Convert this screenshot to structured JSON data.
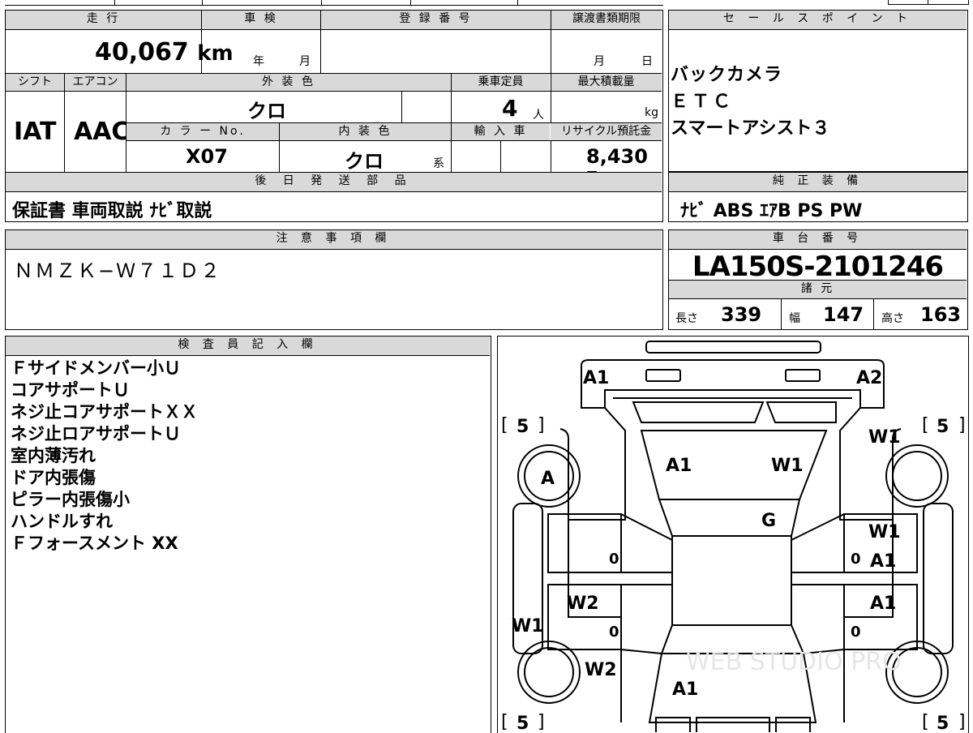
{
  "top": {
    "headers": {
      "mileage": "走 行",
      "shaken": "車 検",
      "reg_no": "登 録 番 号",
      "transfer_deadline": "譲渡書類期限",
      "shift": "シフト",
      "aircon": "エアコン",
      "exterior_color": "外 装 色",
      "capacity": "乗車定員",
      "max_load": "最大積載量",
      "color_no": "カ ラ ー No.",
      "interior_color": "内 装 色",
      "import": "輸 入 車",
      "recycle_fee": "リサイクル預託金",
      "post_parts": "後 日 発 送 部 品"
    },
    "mileage": "40,067",
    "mileage_unit": "km",
    "shaken_year": "年",
    "shaken_month": "月",
    "deadline_month": "月",
    "deadline_day": "日",
    "shift": "IAT",
    "aircon": "AAC",
    "exterior_color": "クロ",
    "capacity": "4",
    "capacity_unit": "人",
    "load_unit": "kg",
    "color_no": "X07",
    "interior_color": "クロ",
    "interior_suffix": "系",
    "recycle_fee": "8,430",
    "recycle_unit": "円",
    "post_parts": "保証書 車両取説 ﾅﾋﾞ取説"
  },
  "sales": {
    "header": "セ ー ル ス ポ イ ン ト",
    "items": [
      "バックカメラ",
      "ＥＴＣ",
      "スマートアシスト３"
    ]
  },
  "equipment": {
    "header": "純 正 装 備",
    "value": "ﾅﾋﾞ ABS ｴｱB PS PW"
  },
  "notes": {
    "header": "注 意 事 項 欄",
    "value": "ＮＭＺＫ−Ｗ７１Ｄ２"
  },
  "chassis": {
    "header": "車 台 番 号",
    "value": "LA150S-2101246",
    "specs_header": "諸 元",
    "length_label": "長さ",
    "length": "339",
    "width_label": "幅",
    "width": "147",
    "height_label": "高さ",
    "height": "163"
  },
  "inspector": {
    "header": "検 査 員 記 入 欄",
    "items": [
      "Ｆサイドメンバー小Ｕ",
      "コアサポートＵ",
      "ネジ止コアサポートＸＸ",
      "ネジ止ロアサポートＵ",
      "室内薄汚れ",
      "ドア内張傷",
      "ピラー内張傷小",
      "ハンドルすれ",
      "Ｆフォースメント XX"
    ]
  },
  "diagram": {
    "marks": {
      "front_left": "A1",
      "front_right": "A2",
      "hood_left": "A1",
      "hood_right": "W1",
      "wheel_fl": "A",
      "windshield": "G",
      "right_front_1": "W1",
      "right_front_2": "W1",
      "right_door1": "A1",
      "right_door2": "A1",
      "left_rear_door": "W2",
      "left_side": "W1",
      "left_rear": "W2",
      "roof_rear": "A1"
    },
    "tire_tread": "5",
    "zero": "0",
    "watermark": "WEB STUDIO PRO"
  }
}
